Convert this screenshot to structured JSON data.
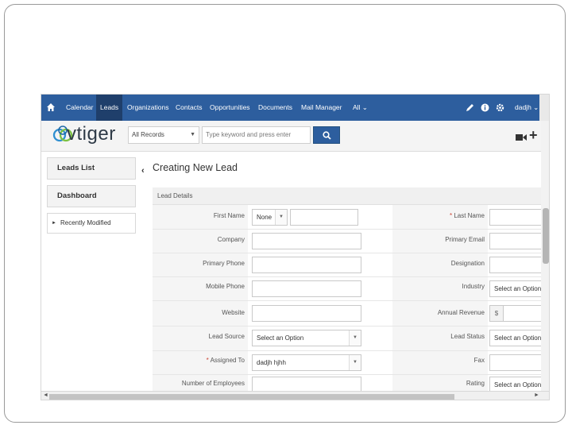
{
  "nav": {
    "items": [
      "Calendar",
      "Leads",
      "Organizations",
      "Contacts",
      "Opportunities",
      "Documents",
      "Mail Manager",
      "All ⌄"
    ],
    "active": "Leads",
    "user": "dadjh ⌄"
  },
  "search": {
    "logo_text": "vtiger",
    "records_value": "All Records",
    "placeholder": "Type keyword and press enter"
  },
  "sidebar": {
    "leads_list": "Leads List",
    "dashboard": "Dashboard",
    "recently_modified": "Recently Modified"
  },
  "form": {
    "title": "Creating New Lead",
    "section": "Lead Details",
    "left_labels": [
      "First Name",
      "Company",
      "Primary Phone",
      "Mobile Phone",
      "Website",
      "Lead Source",
      "Assigned To",
      "Number of Employees"
    ],
    "right_labels": [
      "Last Name",
      "Primary Email",
      "Designation",
      "Industry",
      "Annual Revenue",
      "Lead Status",
      "Fax",
      "Rating"
    ],
    "salutation_value": "None",
    "lead_source_value": "Select an Option",
    "assigned_to_value": "dadjh hjhh",
    "industry_value": "Select an Option",
    "lead_status_value": "Select an Option",
    "rating_value": "Select an Option",
    "currency_symbol": "$",
    "required_mark": "* "
  },
  "colors": {
    "nav_bg": "#2d5e9e",
    "nav_active": "#1f3f6b",
    "required": "#cc4433"
  }
}
